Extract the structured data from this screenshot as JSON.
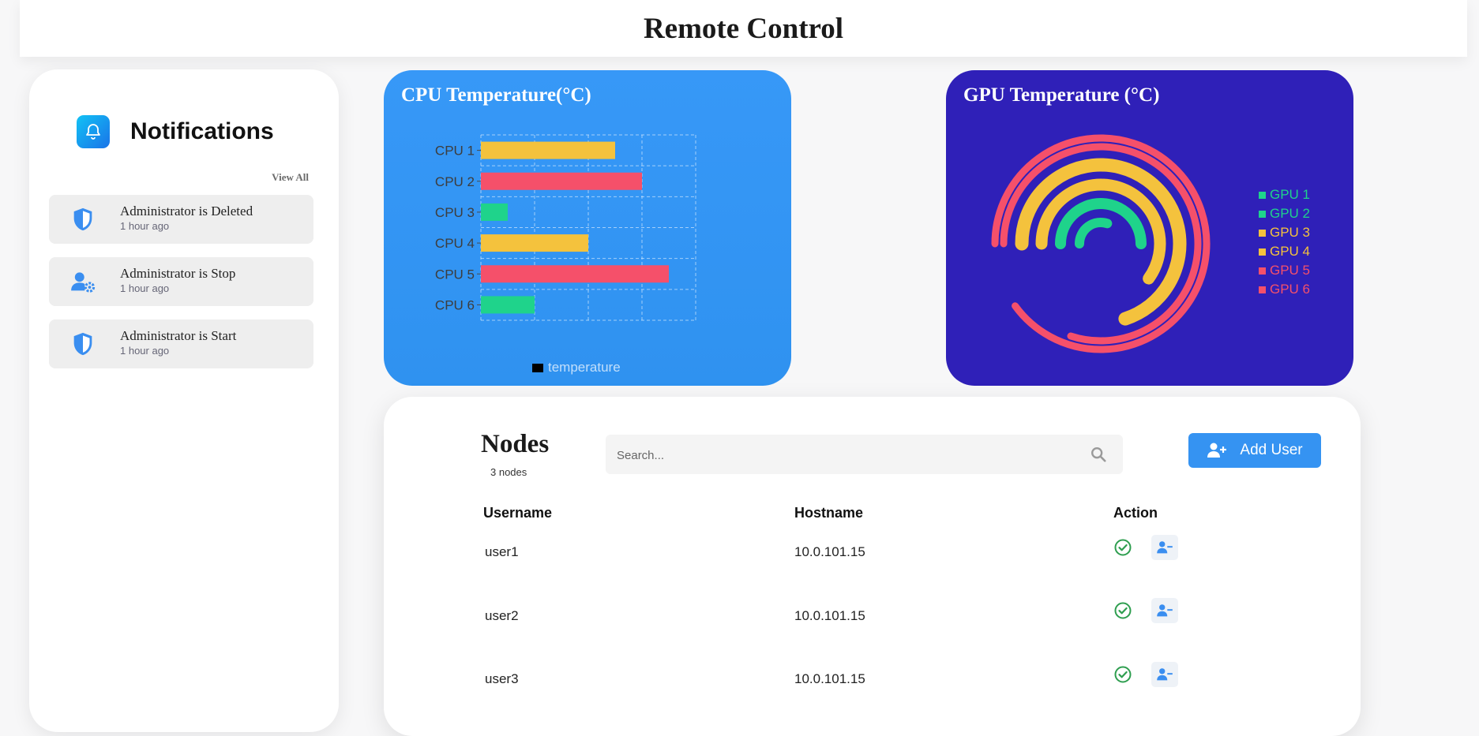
{
  "header": {
    "title": "Remote Control"
  },
  "notifications": {
    "title": "Notifications",
    "view_all": "View All",
    "items": [
      {
        "text": "Administrator is Deleted",
        "time": "1 hour ago",
        "icon": "shield-icon"
      },
      {
        "text": "Administrator is Stop",
        "time": "1 hour ago",
        "icon": "user-gear-icon"
      },
      {
        "text": "Administrator is Start",
        "time": "1 hour ago",
        "icon": "shield-icon"
      }
    ]
  },
  "cpu": {
    "title": "CPU Temperature(°C)"
  },
  "gpu": {
    "title": "GPU Temperature (°C)"
  },
  "chart_data": [
    {
      "type": "bar",
      "orientation": "horizontal",
      "title": "CPU Temperature(°C)",
      "categories": [
        "CPU 1",
        "CPU 2",
        "CPU 3",
        "CPU 4",
        "CPU 5",
        "CPU 6"
      ],
      "series": [
        {
          "name": "temperature",
          "values": [
            50,
            60,
            10,
            40,
            70,
            20
          ]
        }
      ],
      "bar_colors": [
        "#f4c23d",
        "#f5506a",
        "#1fd38b",
        "#f4c23d",
        "#f5506a",
        "#1fd38b"
      ],
      "xlim": [
        0,
        80
      ],
      "grid": true,
      "legend": "bottom"
    },
    {
      "type": "radial-bar",
      "title": "GPU Temperature (°C)",
      "categories": [
        "GPU 1",
        "GPU 2",
        "GPU 3",
        "GPU 4",
        "GPU 5",
        "GPU 6"
      ],
      "values": [
        30,
        50,
        60,
        70,
        80,
        90
      ],
      "max": 100,
      "colors": [
        "#1fd38b",
        "#1fd38b",
        "#f4c23d",
        "#f4c23d",
        "#f5506a",
        "#f5506a"
      ],
      "legend": "right"
    }
  ],
  "nodes": {
    "title": "Nodes",
    "count_text": "3 nodes",
    "search_placeholder": "Search...",
    "add_button": "Add User",
    "columns": [
      "Username",
      "Hostname",
      "Action"
    ],
    "rows": [
      {
        "username": "user1",
        "hostname": "10.0.101.15"
      },
      {
        "username": "user2",
        "hostname": "10.0.101.15"
      },
      {
        "username": "user3",
        "hostname": "10.0.101.15"
      }
    ]
  },
  "colors": {
    "cpu_card": "#3394f5",
    "gpu_card": "#2f20b8",
    "accent": "#3593f2",
    "success": "#2e9e4f"
  }
}
